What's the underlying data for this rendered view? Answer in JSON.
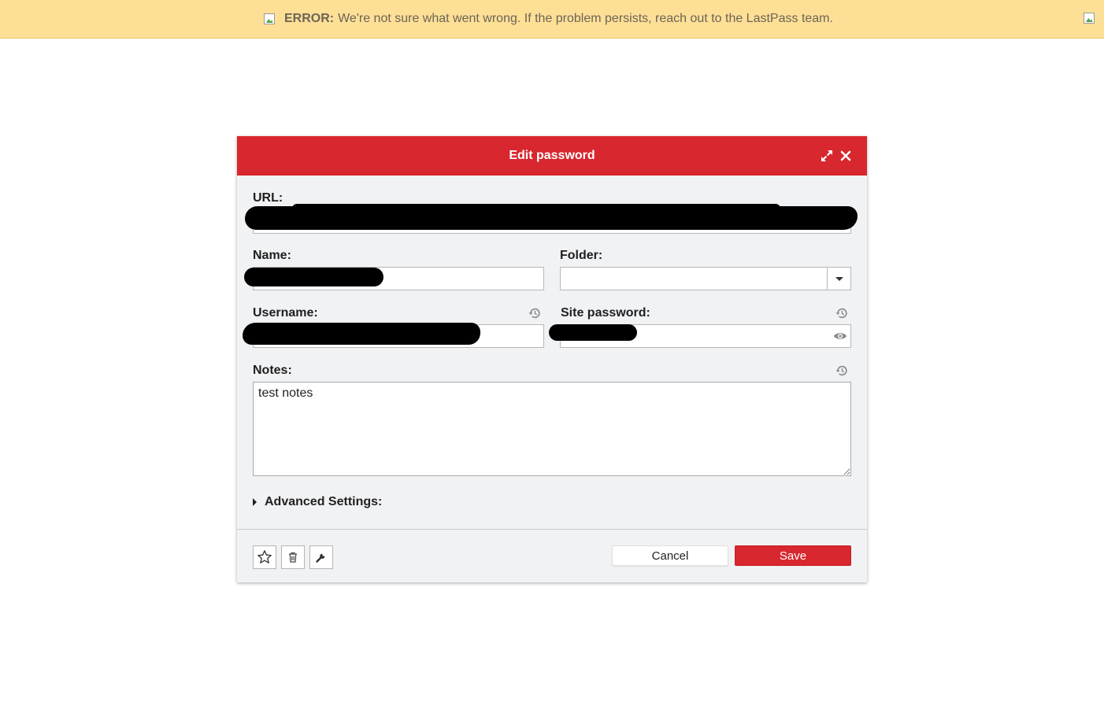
{
  "banner": {
    "prefix": "ERROR:",
    "message": "We're not sure what went wrong. If the problem persists, reach out to the LastPass team."
  },
  "dialog": {
    "title": "Edit password",
    "fields": {
      "url_label": "URL:",
      "name_label": "Name:",
      "folder_label": "Folder:",
      "username_label": "Username:",
      "site_password_label": "Site password:",
      "notes_label": "Notes:",
      "notes_value": "test notes"
    },
    "advanced_label": "Advanced Settings:",
    "buttons": {
      "cancel": "Cancel",
      "save": "Save"
    },
    "icons": {
      "expand": "expand-icon",
      "close": "close-icon",
      "history": "history-icon",
      "eye": "eye-icon",
      "favorite": "star-icon",
      "delete": "trash-icon",
      "tools": "wrench-icon"
    }
  },
  "colors": {
    "accent": "#d8272e",
    "banner_bg": "#fedf96",
    "dialog_bg": "#f1f2f4"
  }
}
